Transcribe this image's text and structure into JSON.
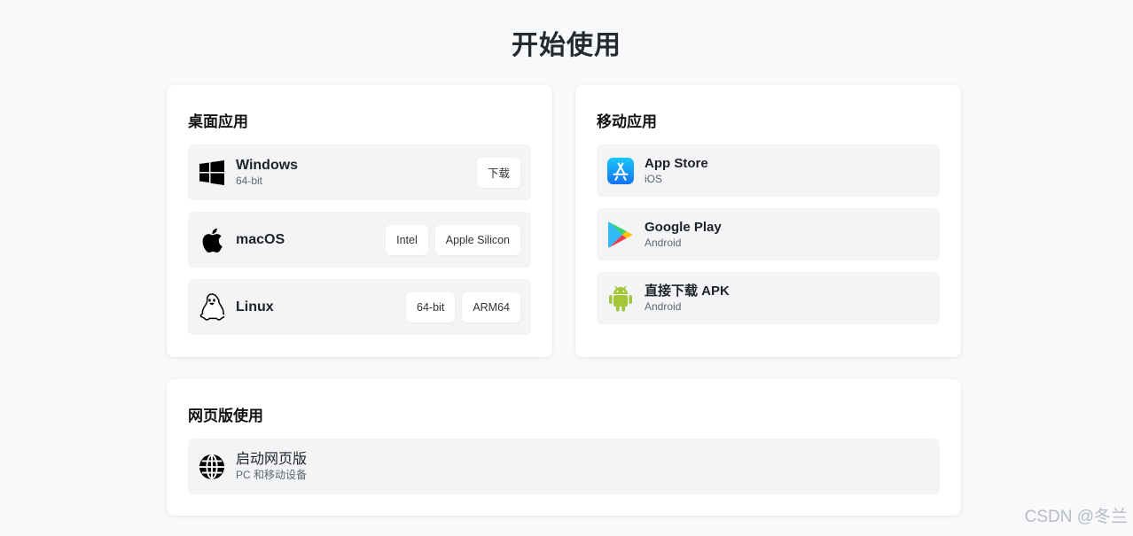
{
  "page": {
    "title": "开始使用"
  },
  "desktop": {
    "title": "桌面应用",
    "windows": {
      "name": "Windows",
      "sub": "64-bit",
      "download": "下载"
    },
    "macos": {
      "name": "macOS",
      "intel": "Intel",
      "apple_silicon": "Apple Silicon"
    },
    "linux": {
      "name": "Linux",
      "bit64": "64-bit",
      "arm64": "ARM64"
    }
  },
  "mobile": {
    "title": "移动应用",
    "appstore": {
      "name": "App Store",
      "sub": "iOS"
    },
    "googleplay": {
      "name": "Google Play",
      "sub": "Android"
    },
    "apk": {
      "name": "直接下载 APK",
      "sub": "Android"
    }
  },
  "web": {
    "title": "网页版使用",
    "launch": {
      "name": "启动网页版",
      "sub": "PC 和移动设备"
    }
  },
  "watermark": "CSDN @冬兰",
  "icons": [
    "windows-icon",
    "apple-icon",
    "linux-icon",
    "app-store-icon",
    "google-play-icon",
    "android-icon",
    "globe-icon"
  ],
  "colors": {
    "background": "#f8f9fb",
    "card": "#ffffff",
    "row": "#f3f4f6",
    "appstore_blue": "#1a8cff",
    "android_green": "#a4c639"
  }
}
